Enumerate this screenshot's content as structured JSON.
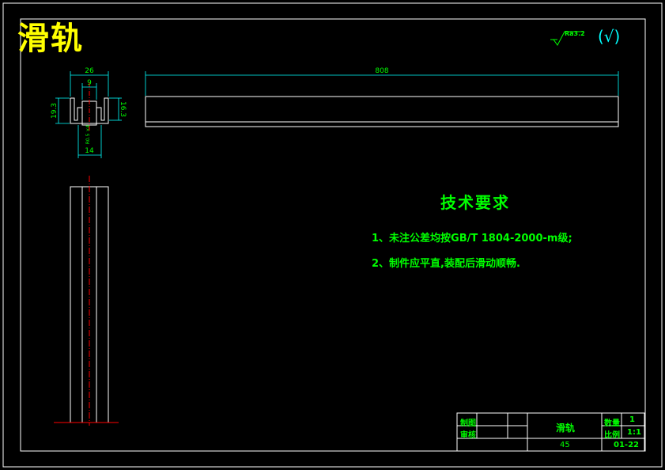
{
  "drawing": {
    "title": "滑轨",
    "roughness": "Ra3.2",
    "roughness_paren": "(√)",
    "dimensions": {
      "overall_length": "808",
      "width_top": "26",
      "slot_width": "9",
      "height_left": "19.3",
      "height_right": "16.3",
      "bottom_width": "14",
      "small_note": "R0.5 ×4"
    },
    "tech_requirements": {
      "title": "技术要求",
      "items": [
        "1、未注公差均按GB/T 1804-2000-m级;",
        "2、制件应平直,装配后滑动顺畅."
      ]
    },
    "title_block": {
      "designer_label": "制图",
      "checker_label": "审核",
      "part_name": "滑轨",
      "quantity_label": "数量",
      "quantity_value": "1",
      "scale_label": "比例",
      "scale_value": "1:1",
      "material": "45",
      "drawing_no": "01-22"
    },
    "colors": {
      "background": "#000000",
      "outline": "#ffffff",
      "dimension": "#00ffff",
      "text": "#00ff00",
      "title": "#ffff00",
      "centerline": "#ff0000"
    }
  }
}
